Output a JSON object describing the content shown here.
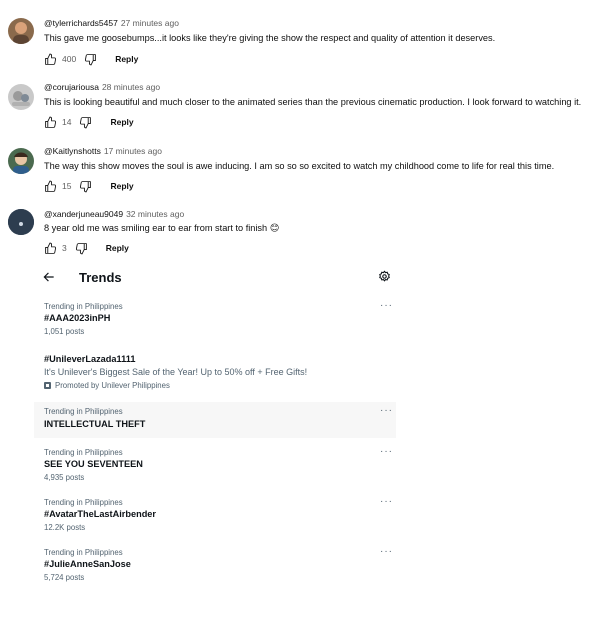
{
  "comments": [
    {
      "author": "@tylerrichards5457",
      "time": "27 minutes ago",
      "text": "This gave me goosebumps...it looks like they're giving the show the respect and quality of attention it deserves.",
      "likes": "400",
      "reply_label": "Reply",
      "avatar_color": "#8a6a4c"
    },
    {
      "author": "@corujariousa",
      "time": "28 minutes ago",
      "text": "This is looking beautiful and much closer to the animated series than the previous cinematic production. I look forward to watching it.",
      "likes": "14",
      "reply_label": "Reply",
      "avatar_color": "#c9c9c9"
    },
    {
      "author": "@Kaitlynshotts",
      "time": "17 minutes ago",
      "text": "The way this show moves the soul is awe inducing. I am so so so excited to watch my childhood come to life for real this time.",
      "likes": "15",
      "reply_label": "Reply",
      "avatar_color": "#4b6a4f"
    },
    {
      "author": "@xanderjuneau9049",
      "time": "32 minutes ago",
      "text": "8 year old me was smiling ear to ear from start to finish 😊",
      "likes": "3",
      "reply_label": "Reply",
      "avatar_color": "#2d3d4f"
    }
  ],
  "trends": {
    "title": "Trends",
    "items": [
      {
        "context": "Trending in Philippines",
        "name": "#AAA2023inPH",
        "posts": "1,051 posts",
        "more": "···"
      },
      {
        "name": "#UnileverLazada1111",
        "description": "It's Unilever's Biggest Sale of the Year! Up to 50% off + Free Gifts!",
        "promoted": "Promoted by Unilever Philippines"
      },
      {
        "context": "Trending in Philippines",
        "name": "INTELLECTUAL THEFT",
        "more": "···"
      },
      {
        "context": "Trending in Philippines",
        "name": "SEE YOU SEVENTEEN",
        "posts": "4,935 posts",
        "more": "···"
      },
      {
        "context": "Trending in Philippines",
        "name": "#AvatarTheLastAirbender",
        "posts": "12.2K posts",
        "more": "···"
      },
      {
        "context": "Trending in Philippines",
        "name": "#JulieAnneSanJose",
        "posts": "5,724 posts",
        "more": "···"
      }
    ]
  },
  "icons": {
    "like": "thumbs-up-icon",
    "dislike": "thumbs-down-icon",
    "back": "arrow-left-icon",
    "settings": "gear-icon",
    "more": "more-horizontal-icon",
    "promoted": "promoted-icon"
  }
}
